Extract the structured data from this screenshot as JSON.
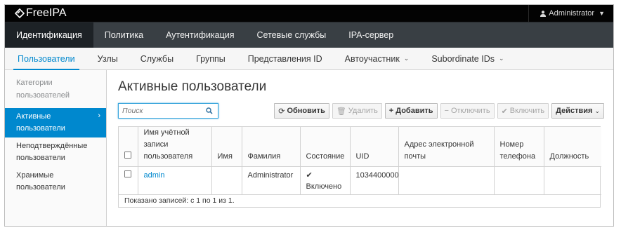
{
  "brand": {
    "name": "FreeIPA"
  },
  "user_menu": {
    "label": "Administrator",
    "icon": "user-icon"
  },
  "primary_nav": [
    "Идентификация",
    "Политика",
    "Аутентификация",
    "Сетевые службы",
    "IPA-сервер"
  ],
  "secondary_nav": [
    {
      "label": "Пользователи",
      "dropdown": false
    },
    {
      "label": "Узлы",
      "dropdown": false
    },
    {
      "label": "Службы",
      "dropdown": false
    },
    {
      "label": "Группы",
      "dropdown": false
    },
    {
      "label": "Представления ID",
      "dropdown": false
    },
    {
      "label": "Автоучастник",
      "dropdown": true
    },
    {
      "label": "Subordinate IDs",
      "dropdown": true
    }
  ],
  "sidebar": {
    "heading": "Категории пользователей",
    "items": [
      "Активные пользователи",
      "Неподтверждённые пользователи",
      "Хранимые пользователи"
    ]
  },
  "page": {
    "title": "Активные пользователи"
  },
  "search": {
    "placeholder": "Поиск"
  },
  "buttons": {
    "refresh": "Обновить",
    "delete": "Удалить",
    "add": "Добавить",
    "disable": "Отключить",
    "enable": "Включить",
    "actions": "Действия"
  },
  "table": {
    "headers": [
      "Имя учётной записи пользователя",
      "Имя",
      "Фамилия",
      "Состояние",
      "UID",
      "Адрес электронной почты",
      "Номер телефона",
      "Должность"
    ],
    "rows": [
      {
        "login": "admin",
        "first": "",
        "last": "Administrator",
        "status": "Включено",
        "uid": "1034400000",
        "email": "",
        "phone": "",
        "title": ""
      }
    ],
    "footer": "Показано записей: с 1 по 1 из 1."
  },
  "colors": {
    "accent": "#0088ce",
    "topbar": "#030303",
    "nav": "#393f44"
  }
}
